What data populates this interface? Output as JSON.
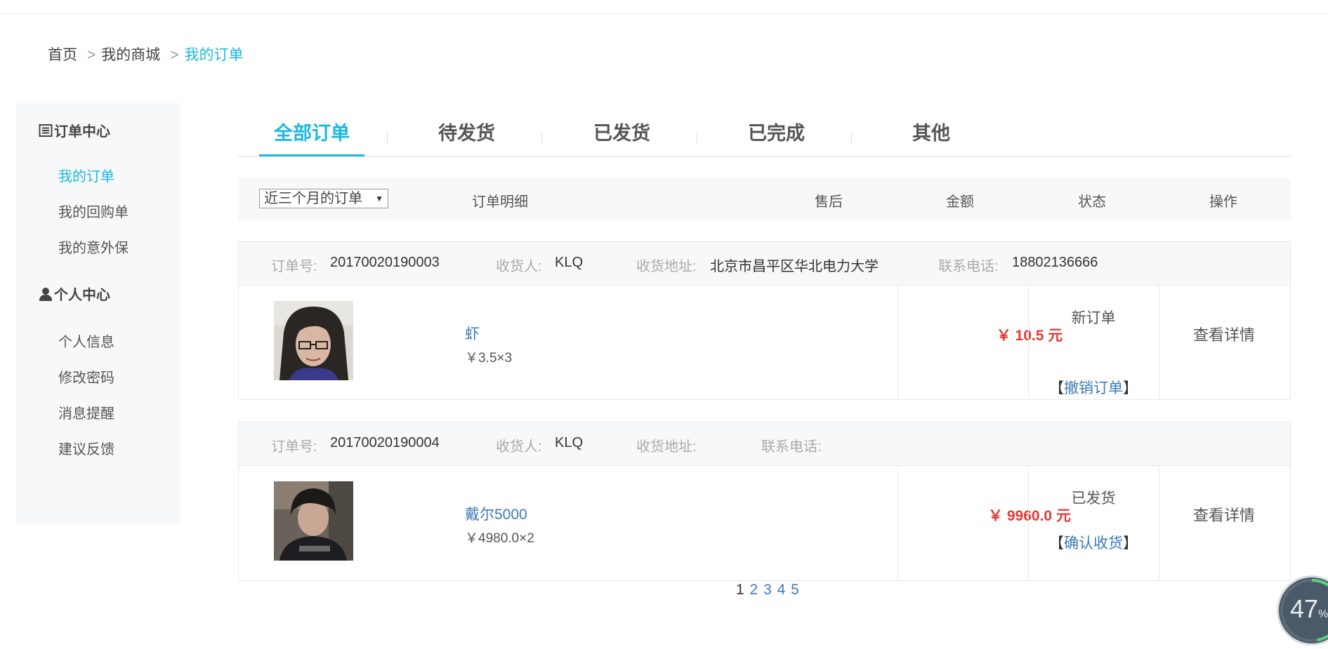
{
  "breadcrumb": {
    "items": [
      {
        "label": "首页"
      },
      {
        "label": "我的商城"
      },
      {
        "label": "我的订单"
      }
    ],
    "separator": ">"
  },
  "sidebar": {
    "sections": [
      {
        "title": "订单中心",
        "icon": "list-icon",
        "items": [
          "我的订单",
          "我的回购单",
          "我的意外保"
        ]
      },
      {
        "title": "个人中心",
        "icon": "user-icon",
        "items": [
          "个人信息",
          "修改密码",
          "消息提醒",
          "建议反馈"
        ]
      }
    ],
    "active_item": "我的订单"
  },
  "tabs": [
    "全部订单",
    "待发货",
    "已发货",
    "已完成",
    "其他"
  ],
  "active_tab": "全部订单",
  "table_header": {
    "filter_select": "近三个月的订单",
    "columns": [
      "订单明细",
      "售后",
      "金额",
      "状态",
      "操作"
    ]
  },
  "order_labels": {
    "order_no": "订单号:",
    "receiver": "收货人:",
    "address": "收货地址:",
    "phone": "联系电话:"
  },
  "orders": [
    {
      "order_no": "20170020190003",
      "receiver": "KLQ",
      "address": "北京市昌平区华北电力大学",
      "phone": "18802136666",
      "product_name": "虾",
      "unit_price": "￥3.5×3",
      "amount": "￥ 10.5 元",
      "status": "新订单",
      "action": "撤销订单",
      "detail": "查看详情"
    },
    {
      "order_no": "20170020190004",
      "receiver": "KLQ",
      "address": "",
      "phone": "",
      "product_name": "戴尔5000",
      "unit_price": "￥4980.0×2",
      "amount": "￥ 9960.0 元",
      "status": "已发货",
      "action": "确认收货",
      "detail": "查看详情"
    }
  ],
  "pagination": {
    "pages": [
      "1",
      "2",
      "3",
      "4",
      "5"
    ],
    "current": "1"
  },
  "speed_widget": {
    "value": "47",
    "unit": "%",
    "fraction": 0.47
  },
  "colors": {
    "accent": "#1cb8e0",
    "price": "#e53935",
    "link": "#3c7ab7"
  }
}
